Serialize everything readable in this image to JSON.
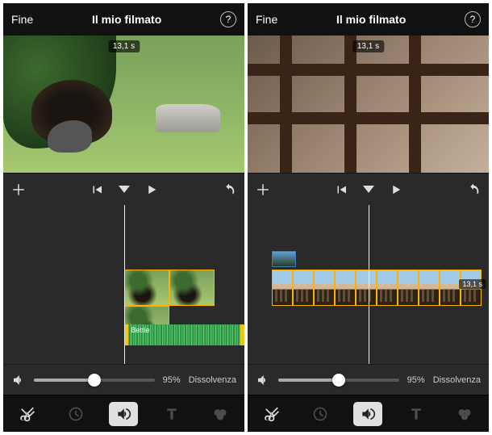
{
  "screens": [
    {
      "header": {
        "done": "Fine",
        "title": "Il mio filmato"
      },
      "preview": {
        "timecode": "13,1 s"
      },
      "audio": {
        "track_name": "Bettie"
      },
      "volume": {
        "percent": "95%",
        "fade_label": "Dissolvenza",
        "value": 0.5
      }
    },
    {
      "header": {
        "done": "Fine",
        "title": "Il mio filmato"
      },
      "preview": {
        "timecode": "13,1 s"
      },
      "timeline": {
        "side_timecode": "13,1 s"
      },
      "volume": {
        "percent": "95%",
        "fade_label": "Dissolvenza",
        "value": 0.5
      }
    }
  ],
  "icons": {
    "help": "?",
    "tools": [
      "cut",
      "speed",
      "volume",
      "text",
      "filter"
    ]
  }
}
